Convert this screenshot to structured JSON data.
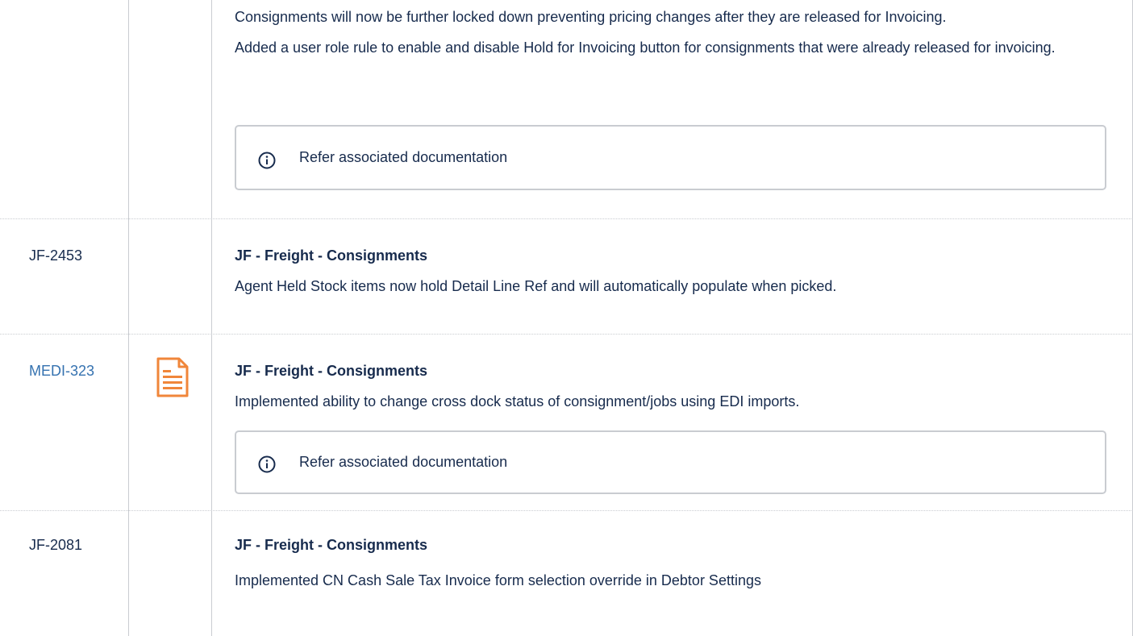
{
  "rows": [
    {
      "key": "",
      "paragraphs": [
        "Consignments will now be further locked down preventing pricing changes after they are released for Invoicing.",
        "Added a user role rule to enable and disable Hold for Invoicing button for consignments that were already released for invoicing."
      ],
      "note": "Refer associated documentation"
    },
    {
      "key": "JF-2453",
      "heading": "JF - Freight - Consignments",
      "paragraphs": [
        "Agent Held Stock items now hold Detail Line Ref and will automatically populate when picked."
      ]
    },
    {
      "key": "MEDI-323",
      "key_link": true,
      "icon": "document-icon",
      "heading": "JF - Freight - Consignments",
      "paragraphs": [
        "Implemented ability to change cross dock status of consignment/jobs using EDI imports."
      ],
      "note": "Refer associated documentation"
    },
    {
      "key": "JF-2081",
      "heading": "JF - Freight - Consignments",
      "paragraphs": [
        "Implemented CN Cash Sale Tax Invoice form selection override in Debtor Settings"
      ]
    }
  ],
  "colors": {
    "link": "#3572b0",
    "border": "#c9ccd1",
    "icon_accent": "#f0863a",
    "text": "#172b4d"
  }
}
